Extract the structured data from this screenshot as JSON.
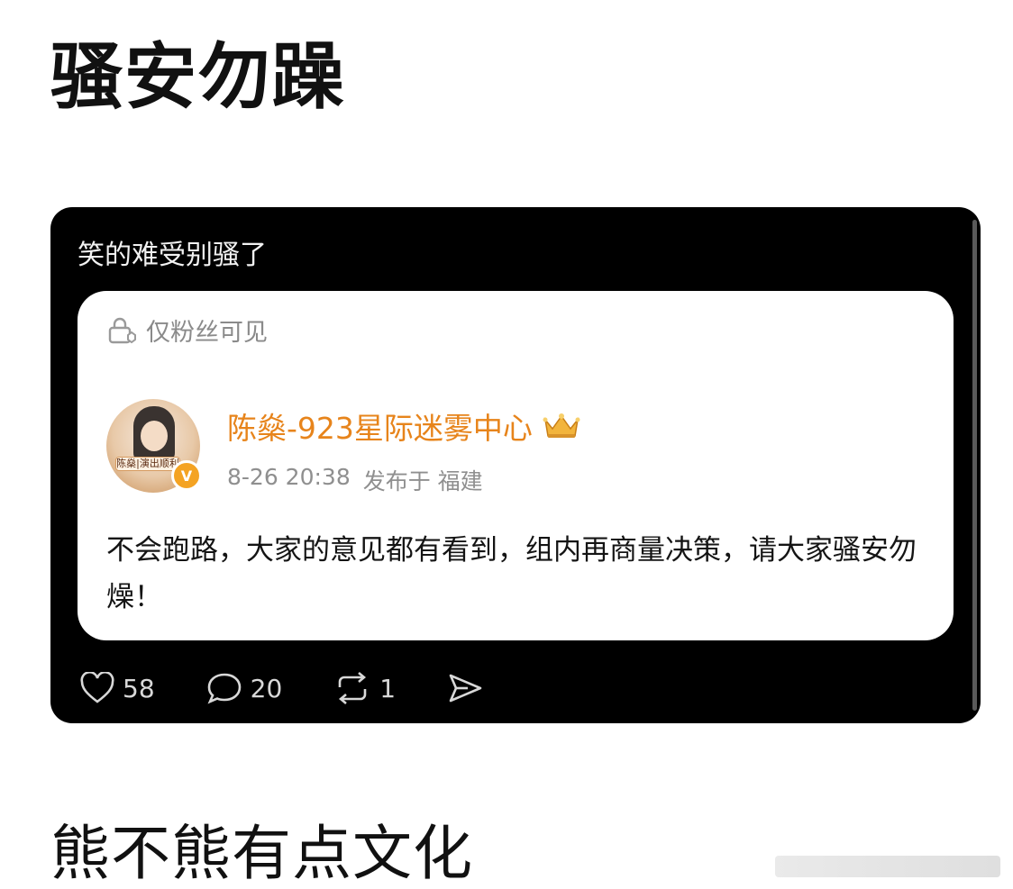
{
  "headline": "骚安勿躁",
  "card": {
    "caption": "笑的难受别骚了",
    "quoted_post": {
      "visibility_label": "仅粉丝可见",
      "author": {
        "name": "陈燊-923星际迷雾中心",
        "avatar_badge_text": "陈燊|演出顺利",
        "verified_mark": "V"
      },
      "meta": {
        "time": "8-26 20:38",
        "published_in": "发布于 福建"
      },
      "text": "不会跑路，大家的意见都有看到，组内再商量决策，请大家骚安勿燥！"
    },
    "actions": {
      "like_count": "58",
      "comment_count": "20",
      "repost_count": "1"
    }
  },
  "bottom_text": "熊不熊有点文化",
  "colors": {
    "card_bg": "#000000",
    "author_name": "#e7841b",
    "verified_badge": "#f4a323"
  }
}
